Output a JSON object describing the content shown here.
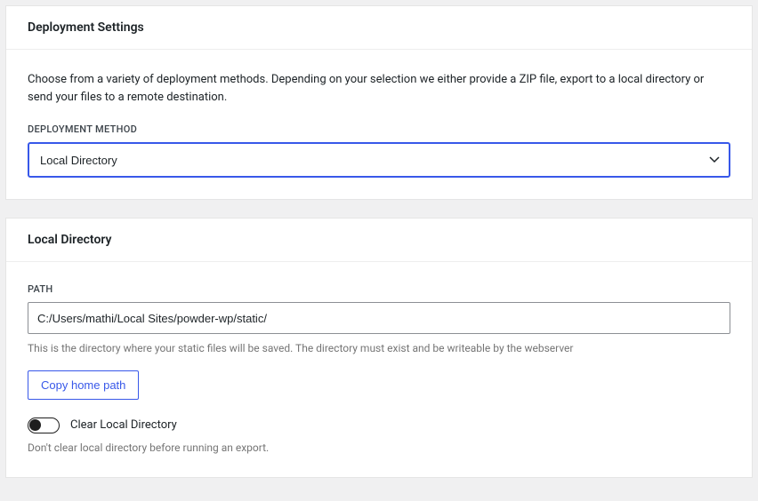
{
  "deployment": {
    "header": "Deployment Settings",
    "intro": "Choose from a variety of deployment methods. Depending on your selection we either provide a ZIP file, export to a local directory or send your files to a remote destination.",
    "method_label": "DEPLOYMENT METHOD",
    "method_value": "Local Directory"
  },
  "local_dir": {
    "header": "Local Directory",
    "path_label": "PATH",
    "path_value": "C:/Users/mathi/Local Sites/powder-wp/static/",
    "path_help": "This is the directory where your static files will be saved. The directory must exist and be writeable by the webserver",
    "copy_button": "Copy home path",
    "clear_toggle_label": "Clear Local Directory",
    "clear_toggle_state": "off",
    "clear_help": "Don't clear local directory before running an export."
  }
}
